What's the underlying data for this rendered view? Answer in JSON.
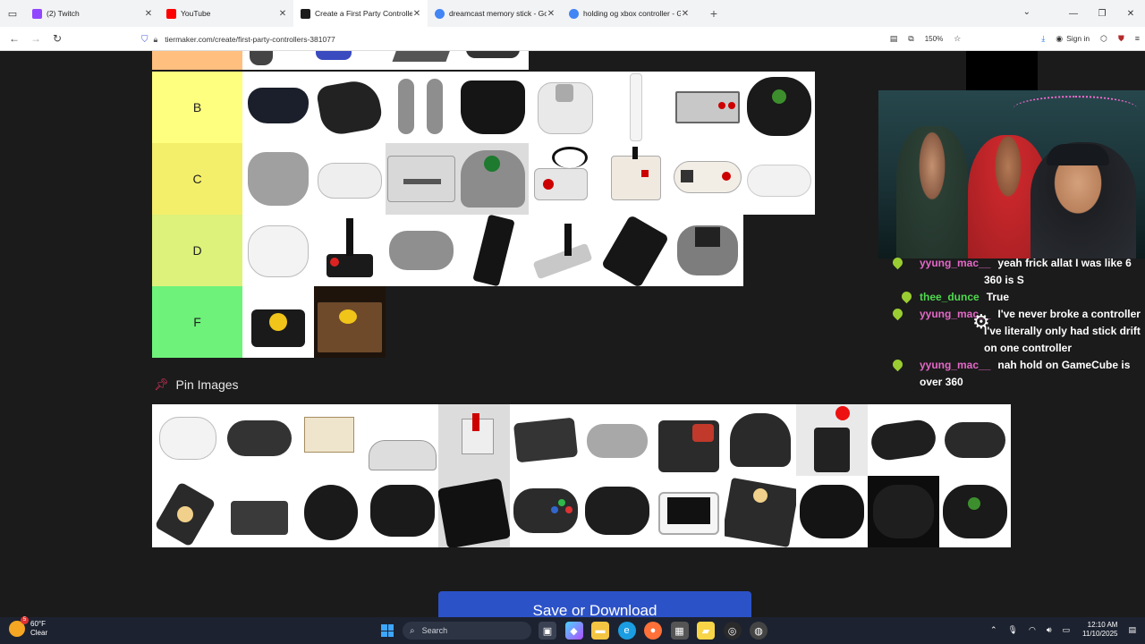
{
  "browser": {
    "tabs": [
      {
        "title": "(2) Twitch",
        "color": "#9146ff",
        "active": false
      },
      {
        "title": "YouTube",
        "color": "#ff0000",
        "active": false
      },
      {
        "title": "Create a First Party Controllers",
        "color": "#1b1b1b",
        "active": true
      },
      {
        "title": "dreamcast memory stick - Goo",
        "color": "#4285f4",
        "active": false
      },
      {
        "title": "holding og xbox controller - Go",
        "color": "#4285f4",
        "active": false
      }
    ],
    "url": "tiermaker.com/create/first-party-controllers-381077",
    "zoom": "150%",
    "signin_label": "Sign in"
  },
  "tiers": [
    {
      "label": "B",
      "color": "#ffff7f"
    },
    {
      "label": "C",
      "color": "#f4ef6a"
    },
    {
      "label": "D",
      "color": "#dcf27a"
    },
    {
      "label": "F",
      "color": "#6ef27a"
    }
  ],
  "pin": {
    "title": "Pin Images"
  },
  "save_button": "Save or Download",
  "chat": [
    {
      "user": "yyung_mac__",
      "color": "#e468c8",
      "text": "yeah frick allat I was like 6"
    },
    {
      "user": "",
      "color": "#e468c8",
      "text": "360 is S"
    },
    {
      "user": "thee_dunce",
      "color": "#4ed94e",
      "text": "True"
    },
    {
      "user": "yyung_mac__",
      "color": "#e468c8",
      "text": "I've never broke a controller"
    },
    {
      "user": "",
      "color": "#e468c8",
      "text": "I've literally only had stick drift on one controller"
    },
    {
      "user": "yyung_mac__",
      "color": "#e468c8",
      "text": "nah hold on GameCube is over 360"
    }
  ],
  "taskbar": {
    "temp": "60°F",
    "weather": "Clear",
    "search_placeholder": "Search",
    "time": "12:10 AM",
    "date": "11/10/2025"
  }
}
